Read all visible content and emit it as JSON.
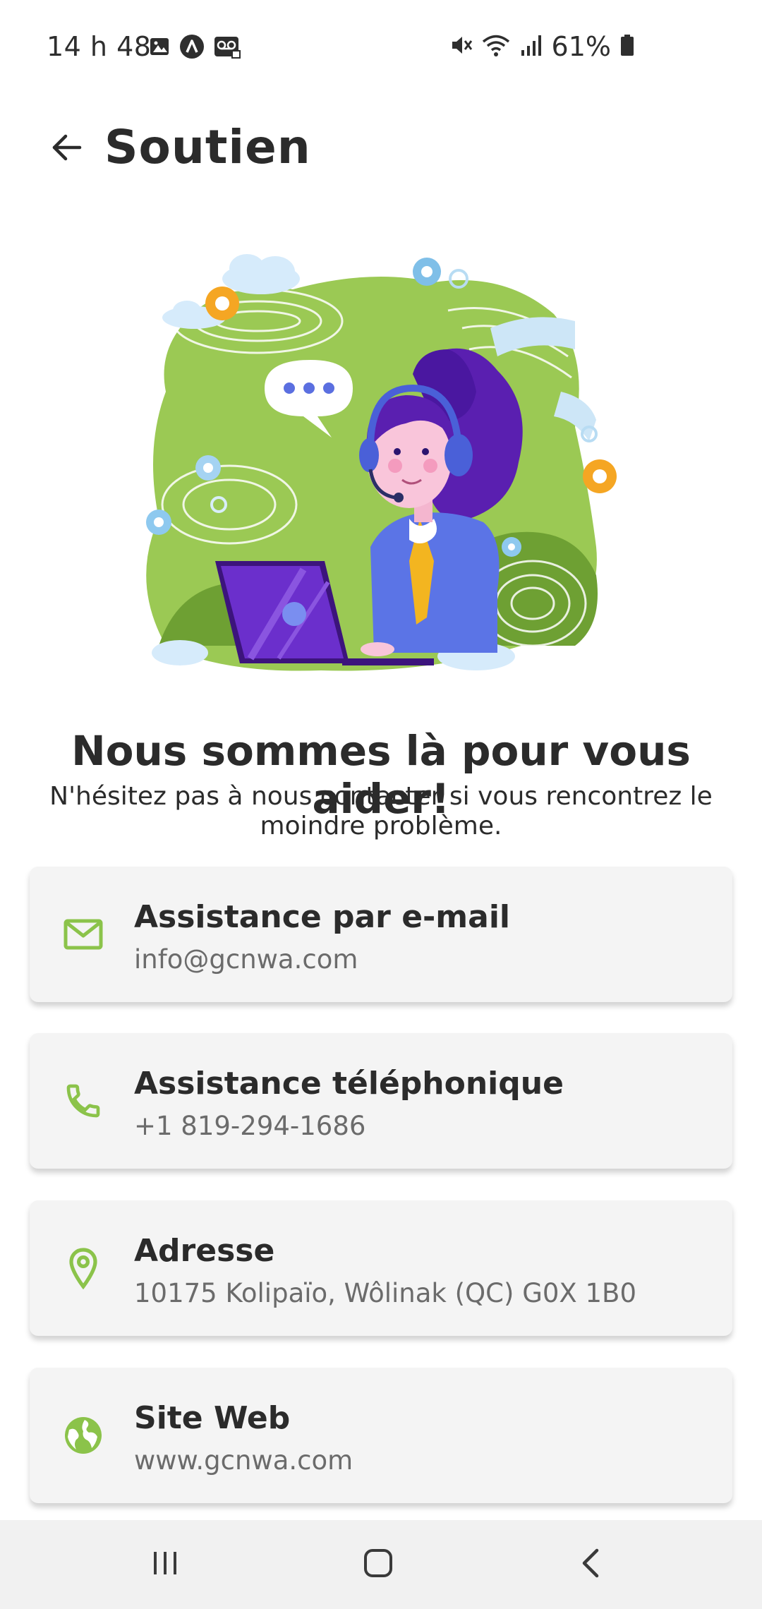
{
  "status_bar": {
    "time": "14 h 48",
    "battery": "61%",
    "left_icons": [
      "gallery-icon",
      "app-logo-icon",
      "voicemail-icon"
    ],
    "right_icons": [
      "mute-icon",
      "wifi-icon",
      "signal-icon",
      "battery-icon"
    ]
  },
  "app_bar": {
    "title": "Soutien",
    "back_icon": "arrow-left-icon"
  },
  "hero": {
    "headline": "Nous sommes là pour vous aider!",
    "subheadline": "N'hésitez pas à nous contacter si vous rencontrez le moindre problème."
  },
  "contacts": [
    {
      "icon": "mail-icon",
      "title": "Assistance par e-mail",
      "value": "info@gcnwa.com"
    },
    {
      "icon": "phone-icon",
      "title": "Assistance téléphonique",
      "value": "+1 819-294-1686"
    },
    {
      "icon": "location-pin-icon",
      "title": "Adresse",
      "value": "10175 Kolipaïo, Wôlinak (QC) G0X 1B0"
    },
    {
      "icon": "globe-icon",
      "title": "Site Web",
      "value": "www.gcnwa.com"
    }
  ],
  "colors": {
    "accent_green": "#8bc34a",
    "card_bg": "#f4f4f4",
    "nav_bg": "#f1f1f1"
  },
  "nav_bar": {
    "icons": [
      "recent-apps-icon",
      "home-icon",
      "back-icon"
    ]
  }
}
